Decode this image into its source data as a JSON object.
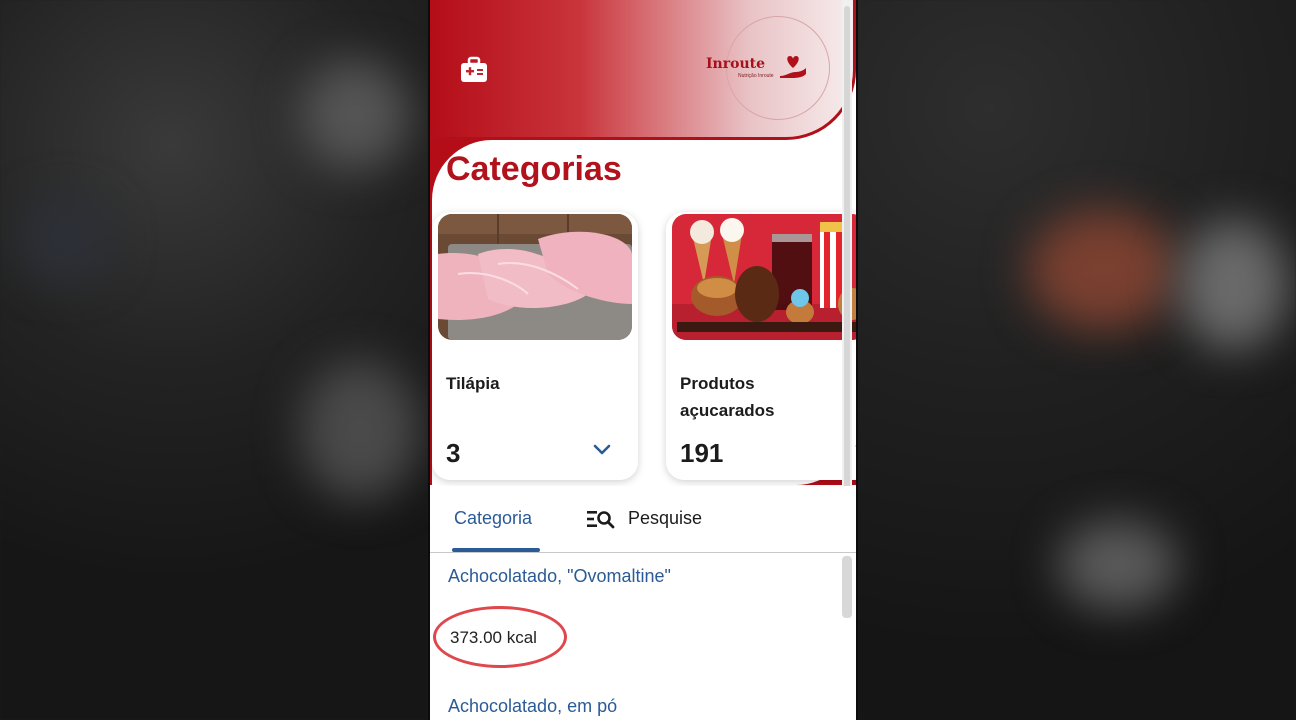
{
  "app": {
    "logo_text": "Inroute",
    "logo_subtext": "Nutrição Inroute",
    "page_title": "Categorias"
  },
  "categories": [
    {
      "name": "Tilápia",
      "count": "3"
    },
    {
      "name": "Produtos açucarados",
      "count": "191"
    }
  ],
  "tabs": {
    "category_label": "Categoria",
    "search_label": "Pesquise"
  },
  "foods": [
    {
      "name": "Achocolatado,  \"Ovomaltine\"",
      "kcal": "373.00 kcal"
    },
    {
      "name": "Achocolatado, em pó"
    }
  ],
  "colors": {
    "brand_red": "#b40d18",
    "link_blue": "#2a5b97",
    "highlight_circle": "#e0474c"
  },
  "icons": [
    "first-aid-kit-icon",
    "heart-hand-logo-icon",
    "chevron-down-icon",
    "search-list-icon"
  ]
}
